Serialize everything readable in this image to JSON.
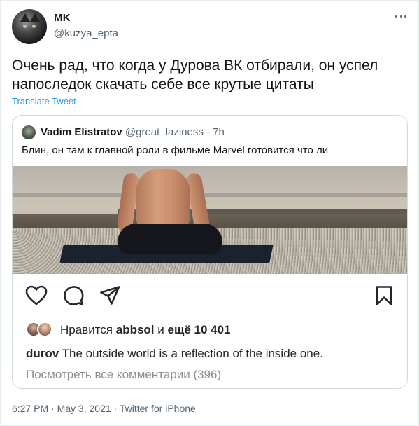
{
  "tweet": {
    "author_name": "MK",
    "author_handle": "@kuzya_epta",
    "text": "Очень рад, что когда у Дурова ВК отбирали, он успел напоследок скачать себе все крутые цитаты",
    "translate_label": "Translate Tweet",
    "timestamp": "6:27 PM",
    "date": "May 3, 2021",
    "source": "Twitter for iPhone",
    "separator": "·"
  },
  "quote": {
    "author_name": "Vadim Elistratov",
    "author_handle": "@great_laziness",
    "separator": "·",
    "time": "7h",
    "text": "Блин, он там к главной роли в фильме Marvel готовится что ли"
  },
  "post": {
    "likes_prefix": "Нравится",
    "liked_by": "abbsol",
    "likes_conjunction": "и",
    "likes_more": "ещё 10 401",
    "caption_user": "durov",
    "caption_text": "The outside world is a reflection of the inside one.",
    "view_comments": "Посмотреть все комментарии (396)"
  },
  "icons": [
    "more-icon",
    "heart-icon",
    "comment-icon",
    "share-icon",
    "bookmark-icon"
  ],
  "colors": {
    "link": "#1d9bf0",
    "secondary": "#536471",
    "border": "#cfd9de"
  }
}
